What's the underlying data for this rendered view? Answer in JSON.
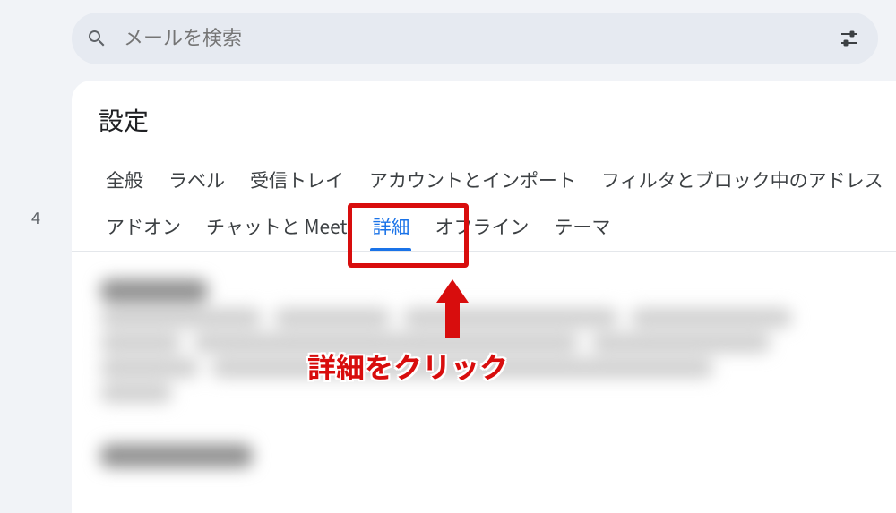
{
  "leftGutter": {
    "count": "4"
  },
  "search": {
    "placeholder": "メールを検索"
  },
  "settings": {
    "title": "設定",
    "tabs": [
      {
        "label": "全般",
        "active": false
      },
      {
        "label": "ラベル",
        "active": false
      },
      {
        "label": "受信トレイ",
        "active": false
      },
      {
        "label": "アカウントとインポート",
        "active": false
      },
      {
        "label": "フィルタとブロック中のアドレス",
        "active": false
      },
      {
        "label": "アドオン",
        "active": false
      },
      {
        "label": "チャットと Meet",
        "active": false
      },
      {
        "label": "詳細",
        "active": true
      },
      {
        "label": "オフライン",
        "active": false
      },
      {
        "label": "テーマ",
        "active": false
      }
    ]
  },
  "annotation": {
    "label": "詳細をクリック"
  }
}
